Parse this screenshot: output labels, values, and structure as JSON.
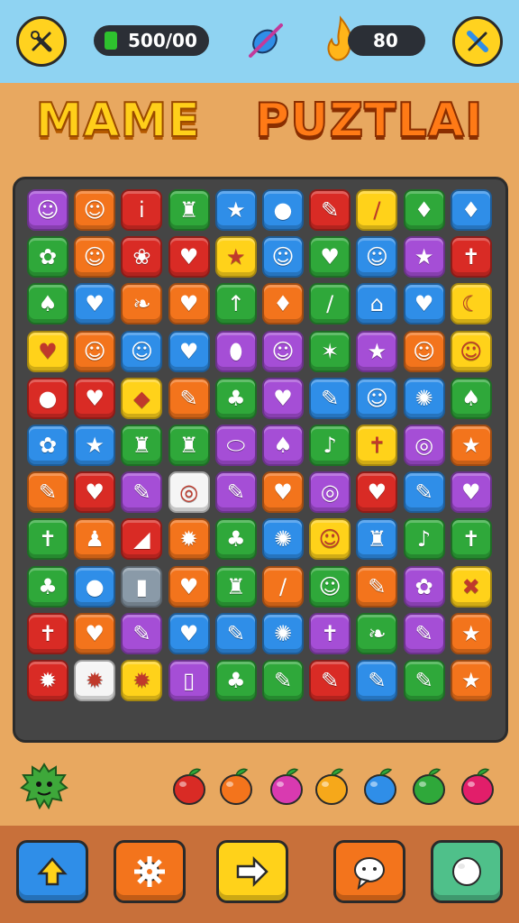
{
  "header": {
    "energy_text": "500/00",
    "coin_text": "80"
  },
  "title": {
    "word1": "MAME",
    "word2": "PUZTLAI"
  },
  "board": {
    "rows": [
      [
        [
          "purple",
          "☺"
        ],
        [
          "orange",
          "☺"
        ],
        [
          "red",
          "i"
        ],
        [
          "green",
          "♜"
        ],
        [
          "blue",
          "★"
        ],
        [
          "blue",
          "●"
        ],
        [
          "red",
          "✎"
        ],
        [
          "yellow",
          "/"
        ],
        [
          "green",
          "♦"
        ],
        [
          "blue",
          "♦"
        ]
      ],
      [
        [
          "green",
          "✿"
        ],
        [
          "orange",
          "☺"
        ],
        [
          "red",
          "❀"
        ],
        [
          "red",
          "♥"
        ],
        [
          "yellow",
          "★"
        ],
        [
          "blue",
          "☺"
        ],
        [
          "green",
          "♥"
        ],
        [
          "blue",
          "☺"
        ],
        [
          "purple",
          "★"
        ],
        [
          "red",
          "✝"
        ]
      ],
      [
        [
          "green",
          "♠"
        ],
        [
          "blue",
          "♥"
        ],
        [
          "orange",
          "❧"
        ],
        [
          "orange",
          "♥"
        ],
        [
          "green",
          "↑"
        ],
        [
          "orange",
          "♦"
        ],
        [
          "green",
          "/"
        ],
        [
          "blue",
          "⌂"
        ],
        [
          "blue",
          "♥"
        ],
        [
          "yellow",
          "☾"
        ]
      ],
      [
        [
          "yellow",
          "♥"
        ],
        [
          "orange",
          "☺"
        ],
        [
          "blue",
          "☺"
        ],
        [
          "blue",
          "♥"
        ],
        [
          "purple",
          "⬮"
        ],
        [
          "purple",
          "☺"
        ],
        [
          "green",
          "✶"
        ],
        [
          "purple",
          "★"
        ],
        [
          "orange",
          "☺"
        ],
        [
          "yellow",
          "☺"
        ]
      ],
      [
        [
          "red",
          "●"
        ],
        [
          "red",
          "♥"
        ],
        [
          "yellow",
          "◆"
        ],
        [
          "orange",
          "✎"
        ],
        [
          "green",
          "♣"
        ],
        [
          "purple",
          "♥"
        ],
        [
          "blue",
          "✎"
        ],
        [
          "blue",
          "☺"
        ],
        [
          "blue",
          "✺"
        ],
        [
          "green",
          "♠"
        ]
      ],
      [
        [
          "blue",
          "✿"
        ],
        [
          "blue",
          "★"
        ],
        [
          "green",
          "♜"
        ],
        [
          "green",
          "♜"
        ],
        [
          "purple",
          "⬭"
        ],
        [
          "purple",
          "♠"
        ],
        [
          "green",
          "♪"
        ],
        [
          "yellow",
          "✝"
        ],
        [
          "purple",
          "◎"
        ],
        [
          "orange",
          "★"
        ]
      ],
      [
        [
          "orange",
          "✎"
        ],
        [
          "red",
          "♥"
        ],
        [
          "purple",
          "✎"
        ],
        [
          "white",
          "◎"
        ],
        [
          "purple",
          "✎"
        ],
        [
          "orange",
          "♥"
        ],
        [
          "purple",
          "◎"
        ],
        [
          "red",
          "♥"
        ],
        [
          "blue",
          "✎"
        ],
        [
          "purple",
          "♥"
        ]
      ],
      [
        [
          "green",
          "✝"
        ],
        [
          "orange",
          "♟"
        ],
        [
          "red",
          "◢"
        ],
        [
          "orange",
          "✹"
        ],
        [
          "green",
          "♣"
        ],
        [
          "blue",
          "✺"
        ],
        [
          "yellow",
          "☺"
        ],
        [
          "blue",
          "♜"
        ],
        [
          "green",
          "♪"
        ],
        [
          "green",
          "✝"
        ]
      ],
      [
        [
          "green",
          "♣"
        ],
        [
          "blue",
          "●"
        ],
        [
          "gray",
          "▮"
        ],
        [
          "orange",
          "♥"
        ],
        [
          "green",
          "♜"
        ],
        [
          "orange",
          "/"
        ],
        [
          "green",
          "☺"
        ],
        [
          "orange",
          "✎"
        ],
        [
          "purple",
          "✿"
        ],
        [
          "yellow",
          "✖"
        ]
      ],
      [
        [
          "red",
          "✝"
        ],
        [
          "orange",
          "♥"
        ],
        [
          "purple",
          "✎"
        ],
        [
          "blue",
          "♥"
        ],
        [
          "blue",
          "✎"
        ],
        [
          "blue",
          "✺"
        ],
        [
          "purple",
          "✝"
        ],
        [
          "green",
          "❧"
        ],
        [
          "purple",
          "✎"
        ],
        [
          "orange",
          "★"
        ]
      ],
      [
        [
          "red",
          "✹"
        ],
        [
          "white",
          "✹"
        ],
        [
          "yellow",
          "✹"
        ],
        [
          "purple",
          "▯"
        ],
        [
          "green",
          "♣"
        ],
        [
          "green",
          "✎"
        ],
        [
          "red",
          "✎"
        ],
        [
          "blue",
          "✎"
        ],
        [
          "green",
          "✎"
        ],
        [
          "orange",
          "★"
        ]
      ]
    ]
  },
  "palette": {
    "red": "#d92b25",
    "orange": "#f3741c",
    "yellow": "#ffd21a",
    "green": "#2fa83a",
    "blue": "#2f8ee8",
    "purple": "#a54ed6",
    "white": "#f5f5f5",
    "gray": "#8a9aa8"
  },
  "tray": {
    "monster_icon": "spiky-monster-icon",
    "items": [
      {
        "icon": "apple-icon",
        "color": "#d92b25"
      },
      {
        "icon": "orange-icon",
        "color": "#f3741c"
      },
      {
        "icon": "berry-icon",
        "color": "#d93ab0"
      },
      {
        "icon": "lemon-icon",
        "color": "#f6a81a"
      },
      {
        "icon": "drop-icon",
        "color": "#2f8ee8"
      },
      {
        "icon": "leaf-icon",
        "color": "#2fa83a"
      },
      {
        "icon": "cherry-icon",
        "color": "#e21e6a"
      }
    ]
  },
  "bottom_buttons": [
    {
      "name": "home-button",
      "icon": "up-arrow-icon",
      "bg": "#2f8ee8"
    },
    {
      "name": "settings-button",
      "icon": "gear-icon",
      "bg": "#f3741c"
    },
    {
      "name": "next-button",
      "icon": "right-arrow-icon",
      "bg": "#ffd21a"
    },
    {
      "name": "chat-button",
      "icon": "speech-bubble-icon",
      "bg": "#f3741c"
    },
    {
      "name": "menu-button",
      "icon": "ball-icon",
      "bg": "#4fc08a"
    }
  ]
}
